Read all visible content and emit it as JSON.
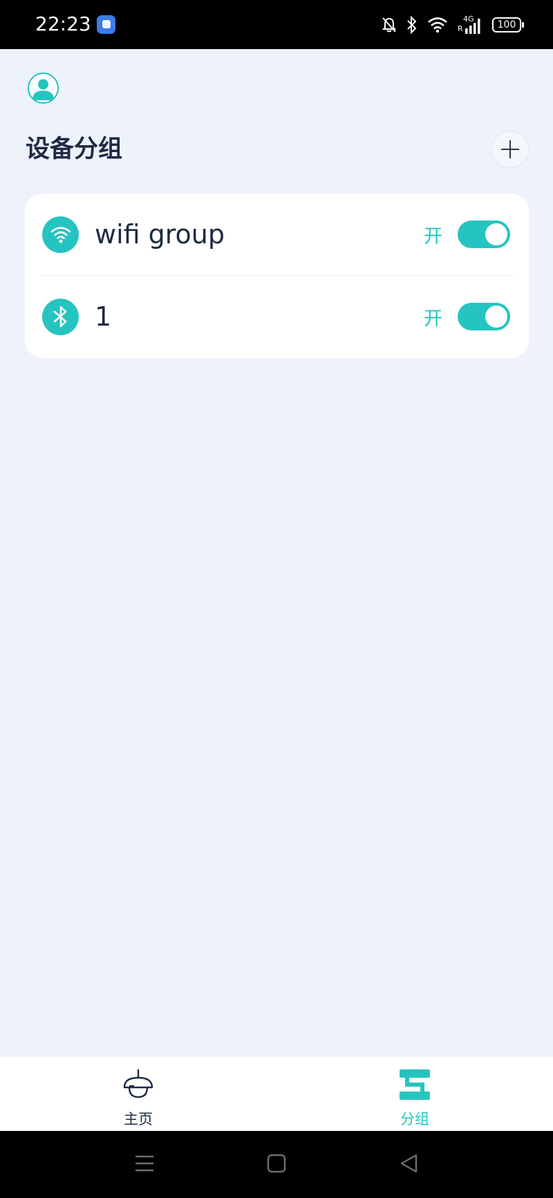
{
  "status_bar": {
    "time": "22:23",
    "battery": "100",
    "network": "4G",
    "roaming": "R",
    "icons": [
      "app-notification-icon",
      "bell-off-icon",
      "bluetooth-icon",
      "wifi-icon",
      "cellular-signal-icon",
      "battery-icon"
    ]
  },
  "header": {
    "title": "设备分组",
    "avatar_icon": "user-icon",
    "add_icon": "plus-icon"
  },
  "groups": [
    {
      "name": "wifi group",
      "icon": "wifi-icon",
      "state": "开",
      "enabled": true
    },
    {
      "name": "1",
      "icon": "bluetooth-icon",
      "state": "开",
      "enabled": true
    }
  ],
  "bottom_nav": {
    "items": [
      {
        "label": "主页",
        "icon": "ceiling-lamp-icon",
        "active": false
      },
      {
        "label": "分组",
        "icon": "group-icon",
        "active": true
      }
    ]
  },
  "system_nav": {
    "icons": [
      "menu-icon",
      "home-square-icon",
      "back-triangle-icon"
    ]
  },
  "colors": {
    "accent": "#26C4C0",
    "background": "#EEF2FA",
    "text_primary": "#1E2A44",
    "card": "#FFFFFF"
  }
}
